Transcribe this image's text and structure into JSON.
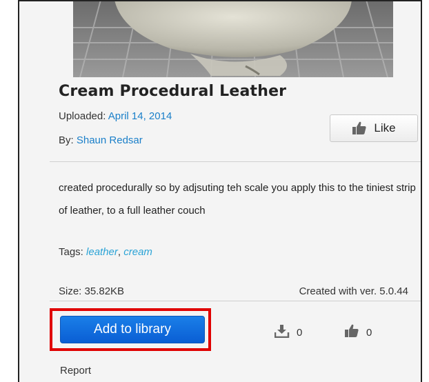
{
  "asset": {
    "title": "Cream Procedural Leather",
    "uploaded_label": "Uploaded:",
    "uploaded_date": "April 14, 2014",
    "by_label": "By:",
    "author": "Shaun Redsar",
    "description": "created procedurally so by adjsuting teh scale you apply this to the tiniest strip of leather, to a full leather couch",
    "tags_label": "Tags:",
    "tags": [
      "leather",
      "cream"
    ],
    "size_text": "Size: 35.82KB",
    "version_text": "Created with ver. 5.0.44"
  },
  "actions": {
    "like_label": "Like",
    "add_to_library_label": "Add to library",
    "report_label": "Report"
  },
  "stats": {
    "downloads": "0",
    "likes": "0"
  },
  "colors": {
    "link": "#1a7fc9",
    "tag": "#2aa3d6",
    "primary_button": "#0a66d9",
    "highlight": "#e00000"
  },
  "icons": {
    "like": "thumbs-up-icon",
    "download": "download-icon",
    "likes_count": "thumbs-up-icon"
  }
}
